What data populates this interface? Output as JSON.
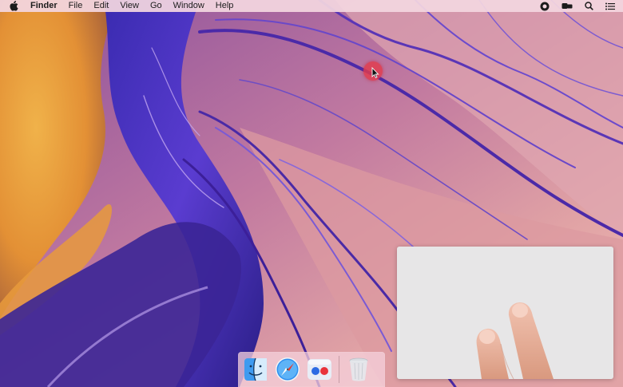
{
  "menubar": {
    "apple_icon": "apple-logo-icon",
    "items": [
      "Finder",
      "File",
      "Edit",
      "View",
      "Go",
      "Window",
      "Help"
    ],
    "status_icons": [
      "screen-recording-icon",
      "display-mirror-icon",
      "search-icon",
      "menu-list-icon"
    ]
  },
  "dock": {
    "apps": [
      {
        "name": "Finder",
        "icon": "finder-icon"
      },
      {
        "name": "Safari",
        "icon": "safari-icon"
      },
      {
        "name": "Camera Sharing",
        "icon": "dots-app-icon"
      }
    ],
    "trash": {
      "name": "Trash",
      "icon": "trash-icon"
    }
  },
  "overlay": {
    "icon": "trackpad-gesture-icon"
  },
  "colors": {
    "menubar": "#f3d6e0",
    "cursor_highlight": "#e23a4c",
    "trackpad": "#e7e6e7"
  }
}
